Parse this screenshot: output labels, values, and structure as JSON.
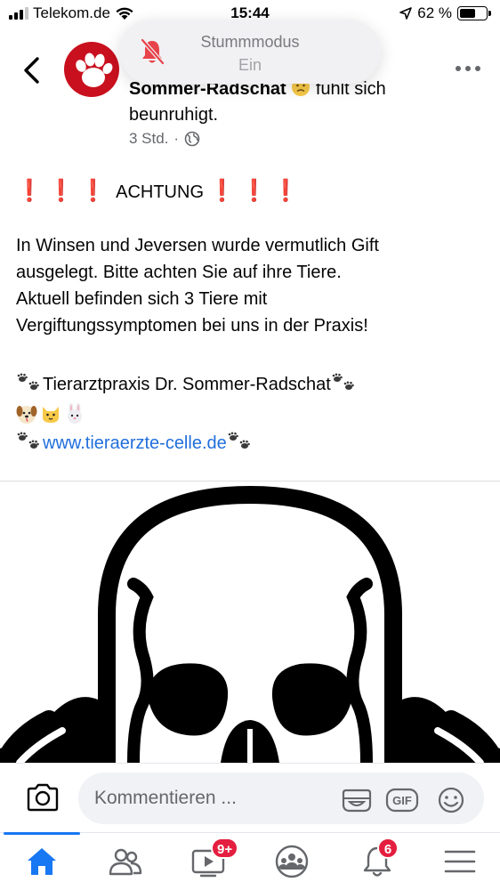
{
  "status_bar": {
    "carrier": "Telekom.de",
    "time": "15:44",
    "battery_percent": "62 %",
    "battery_level": 0.62
  },
  "toast": {
    "title": "Stummmodus",
    "subtitle": "Ein",
    "icon": "bell-slash-icon"
  },
  "post_header": {
    "author": "Sommer-Radschat",
    "feeling": "fühlt sich beunruhigt.",
    "time": "3 Std.",
    "separator": "·",
    "privacy_icon": "globe-icon"
  },
  "post": {
    "achtung": "ACHTUNG",
    "exclamations": "❗❗❗",
    "lines": [
      "In Winsen und Jeversen wurde vermutlich Gift",
      "ausgelegt. Bitte achten Sie auf ihre Tiere.",
      "Aktuell befinden sich 3 Tiere mit",
      "Vergiftungssymptomen bei uns in der Praxis!"
    ],
    "signature": "Tierarztpraxis Dr. Sommer-Radschat",
    "link": "www.tieraerzte-celle.de"
  },
  "comment_bar": {
    "placeholder": "Kommentieren ...",
    "gif_label": "GIF"
  },
  "tab_bar": {
    "video_badge": "9+",
    "notifications_badge": "6"
  },
  "colors": {
    "accent": "#1877f2",
    "badge": "#e41e3f",
    "alert": "#e0141e",
    "link": "#216fdb",
    "avatar": "#c8101e"
  }
}
